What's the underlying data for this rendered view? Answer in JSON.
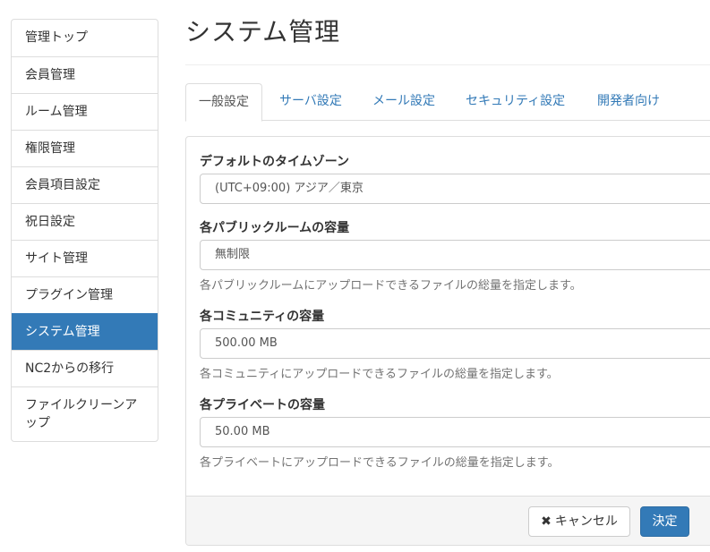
{
  "sidebar": {
    "items": [
      {
        "label": "管理トップ"
      },
      {
        "label": "会員管理"
      },
      {
        "label": "ルーム管理"
      },
      {
        "label": "権限管理"
      },
      {
        "label": "会員項目設定"
      },
      {
        "label": "祝日設定"
      },
      {
        "label": "サイト管理"
      },
      {
        "label": "プラグイン管理"
      },
      {
        "label": "システム管理",
        "active": true
      },
      {
        "label": "NC2からの移行"
      },
      {
        "label": "ファイルクリーンアップ"
      }
    ],
    "active_color": "#337ab7"
  },
  "page": {
    "title": "システム管理"
  },
  "tabs": [
    {
      "label": "一般設定",
      "active": true
    },
    {
      "label": "サーバ設定"
    },
    {
      "label": "メール設定"
    },
    {
      "label": "セキュリティ設定"
    },
    {
      "label": "開発者向け"
    }
  ],
  "form": {
    "timezone": {
      "label": "デフォルトのタイムゾーン",
      "value": "(UTC+09:00) アジア／東京"
    },
    "public_room_capacity": {
      "label": "各パブリックルームの容量",
      "value": "無制限",
      "help": "各パブリックルームにアップロードできるファイルの総量を指定します。"
    },
    "community_capacity": {
      "label": "各コミュニティの容量",
      "value": "500.00 MB",
      "help": "各コミュニティにアップロードできるファイルの総量を指定します。"
    },
    "private_capacity": {
      "label": "各プライベートの容量",
      "value": "50.00 MB",
      "help": "各プライベートにアップロードできるファイルの総量を指定します。"
    }
  },
  "footer": {
    "cancel_icon": "close-icon",
    "cancel_label": "キャンセル",
    "submit_label": "決定"
  }
}
